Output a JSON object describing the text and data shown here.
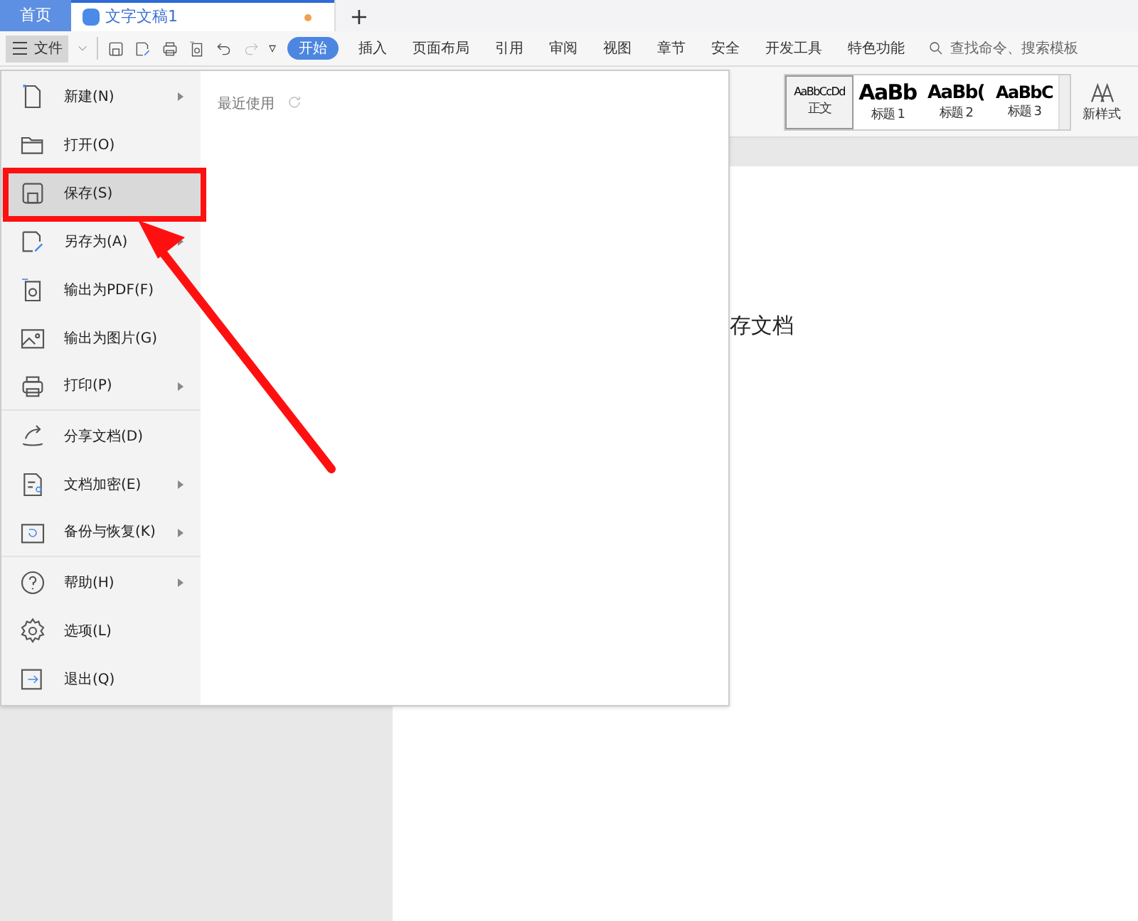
{
  "title_bar": {
    "home_tab": "首页",
    "doc_tab": {
      "title": "文字文稿1",
      "unsaved": true
    },
    "new_tab": "+"
  },
  "toolbar": {
    "file_button": "文件",
    "more": "▿",
    "tabs": [
      {
        "label": "开始",
        "selected": true
      },
      {
        "label": "插入",
        "selected": false
      },
      {
        "label": "页面布局",
        "selected": false
      },
      {
        "label": "引用",
        "selected": false
      },
      {
        "label": "审阅",
        "selected": false
      },
      {
        "label": "视图",
        "selected": false
      },
      {
        "label": "章节",
        "selected": false
      },
      {
        "label": "安全",
        "selected": false
      },
      {
        "label": "开发工具",
        "selected": false
      },
      {
        "label": "特色功能",
        "selected": false
      }
    ],
    "search": {
      "placeholder": "查找命令、搜索模板"
    }
  },
  "ribbon": {
    "styles": [
      {
        "sample": "AaBbCcDd",
        "name": "正文",
        "kind": "body",
        "selected": true
      },
      {
        "sample": "AaBb",
        "name": "标题 1",
        "kind": "h1",
        "selected": false
      },
      {
        "sample": "AaBb(",
        "name": "标题 2",
        "kind": "h2",
        "selected": false
      },
      {
        "sample": "AaBbC",
        "name": "标题 3",
        "kind": "h3",
        "selected": false
      }
    ],
    "new_style": "新样式"
  },
  "document": {
    "text": "存文档"
  },
  "file_menu": {
    "recent_title": "最近使用",
    "items": [
      {
        "label": "新建(N)",
        "submenu": true,
        "selected": false,
        "separator_after": false
      },
      {
        "label": "打开(O)",
        "submenu": false,
        "selected": false,
        "separator_after": false
      },
      {
        "label": "保存(S)",
        "submenu": false,
        "selected": true,
        "separator_after": false
      },
      {
        "label": "另存为(A)",
        "submenu": true,
        "selected": false,
        "separator_after": false
      },
      {
        "label": "输出为PDF(F)",
        "submenu": false,
        "selected": false,
        "separator_after": false
      },
      {
        "label": "输出为图片(G)",
        "submenu": false,
        "selected": false,
        "separator_after": false
      },
      {
        "label": "打印(P)",
        "submenu": true,
        "selected": false,
        "separator_after": true
      },
      {
        "label": "分享文档(D)",
        "submenu": false,
        "selected": false,
        "separator_after": false
      },
      {
        "label": "文档加密(E)",
        "submenu": true,
        "selected": false,
        "separator_after": false
      },
      {
        "label": "备份与恢复(K)",
        "submenu": true,
        "selected": false,
        "separator_after": true
      },
      {
        "label": "帮助(H)",
        "submenu": true,
        "selected": false,
        "separator_after": false
      },
      {
        "label": "选项(L)",
        "submenu": false,
        "selected": false,
        "separator_after": false
      },
      {
        "label": "退出(Q)",
        "submenu": false,
        "selected": false,
        "separator_after": false
      }
    ]
  }
}
